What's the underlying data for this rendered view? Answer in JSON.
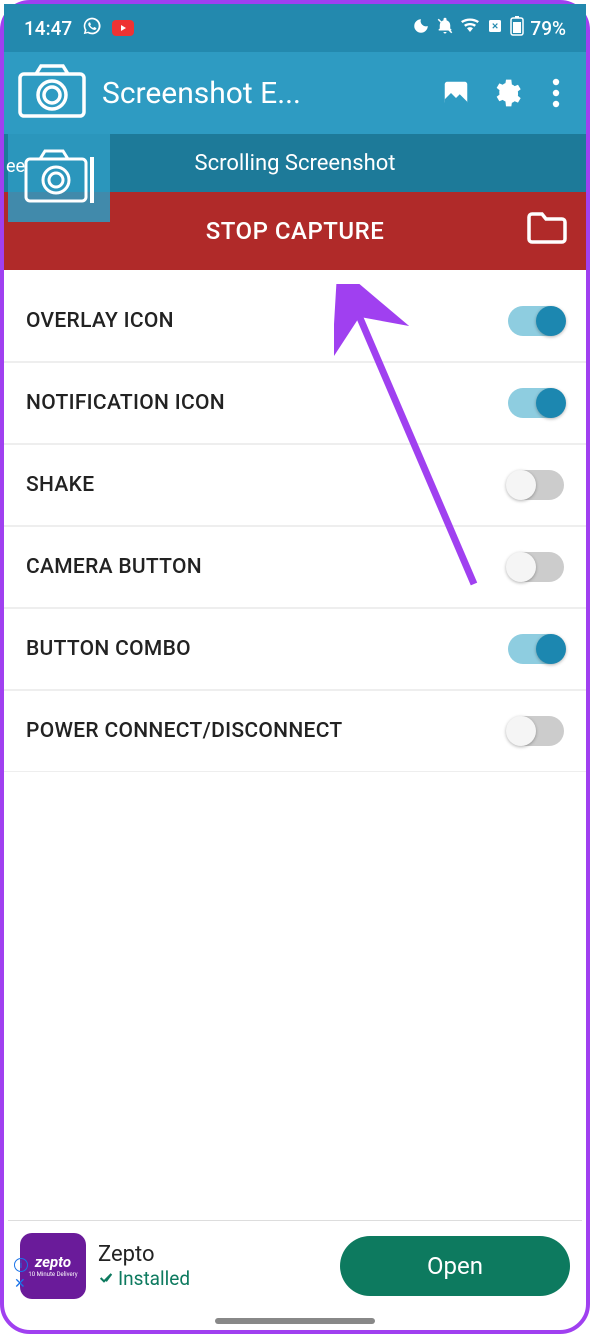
{
  "status": {
    "time": "14:47",
    "battery": "79%"
  },
  "appbar": {
    "title": "Screenshot E..."
  },
  "subheader": {
    "title": "Scrolling Screenshot"
  },
  "overlay_edge_text": "ee",
  "capture": {
    "label": "STOP CAPTURE"
  },
  "settings": [
    {
      "label": "OVERLAY ICON",
      "on": true
    },
    {
      "label": "NOTIFICATION ICON",
      "on": true
    },
    {
      "label": "SHAKE",
      "on": false
    },
    {
      "label": "CAMERA BUTTON",
      "on": false
    },
    {
      "label": "BUTTON COMBO",
      "on": true
    },
    {
      "label": "POWER CONNECT/DISCONNECT",
      "on": false
    }
  ],
  "ad": {
    "brand": "zepto",
    "tagline": "10 Minute Delivery",
    "name": "Zepto",
    "status": "Installed",
    "cta": "Open"
  }
}
